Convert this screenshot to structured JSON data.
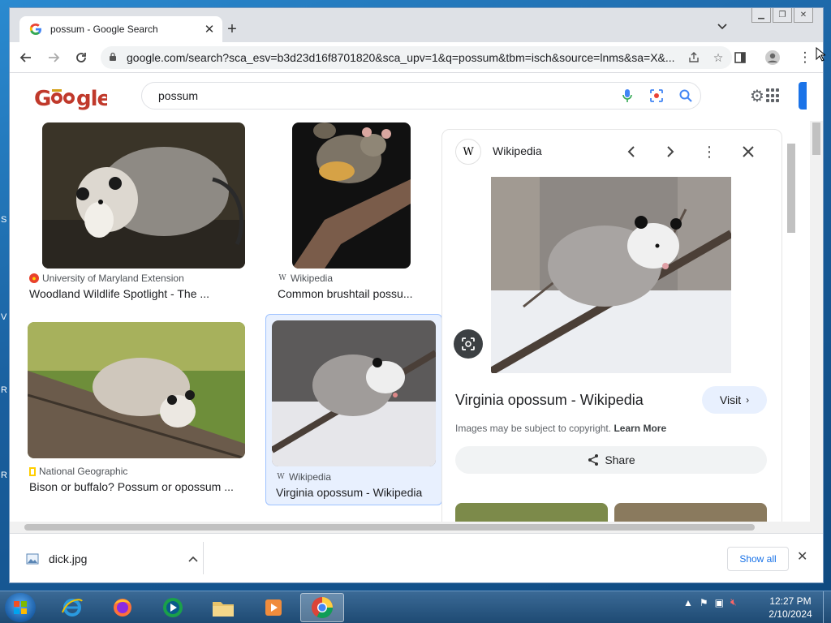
{
  "browser": {
    "tab_title": "possum - Google Search",
    "url": "google.com/search?sca_esv=b3d23d16f8701820&sca_upv=1&q=possum&tbm=isch&source=lnms&sa=X&..."
  },
  "search": {
    "query": "possum"
  },
  "results": [
    {
      "source": "University of Maryland Extension",
      "title": "Woodland Wildlife Spotlight - The ..."
    },
    {
      "source": "Wikipedia",
      "title": "Common brushtail possu..."
    },
    {
      "source": "National Geographic",
      "title": "Bison or buffalo? Possum or opossum ..."
    },
    {
      "source": "Wikipedia",
      "title": "Virginia opossum - Wikipedia",
      "selected": true
    }
  ],
  "panel": {
    "source": "Wikipedia",
    "title": "Virginia opossum - Wikipedia",
    "visit_label": "Visit",
    "copyright_text": "Images may be subject to copyright.",
    "learn_more_label": "Learn More",
    "share_label": "Share"
  },
  "downloads": {
    "file_name": "dick.jpg",
    "show_all_label": "Show all"
  },
  "taskbar": {
    "time": "12:27 PM",
    "date": "2/10/2024"
  },
  "colors": {
    "accent": "#1a73e8",
    "selected_card_bg": "#e8f0fe"
  }
}
